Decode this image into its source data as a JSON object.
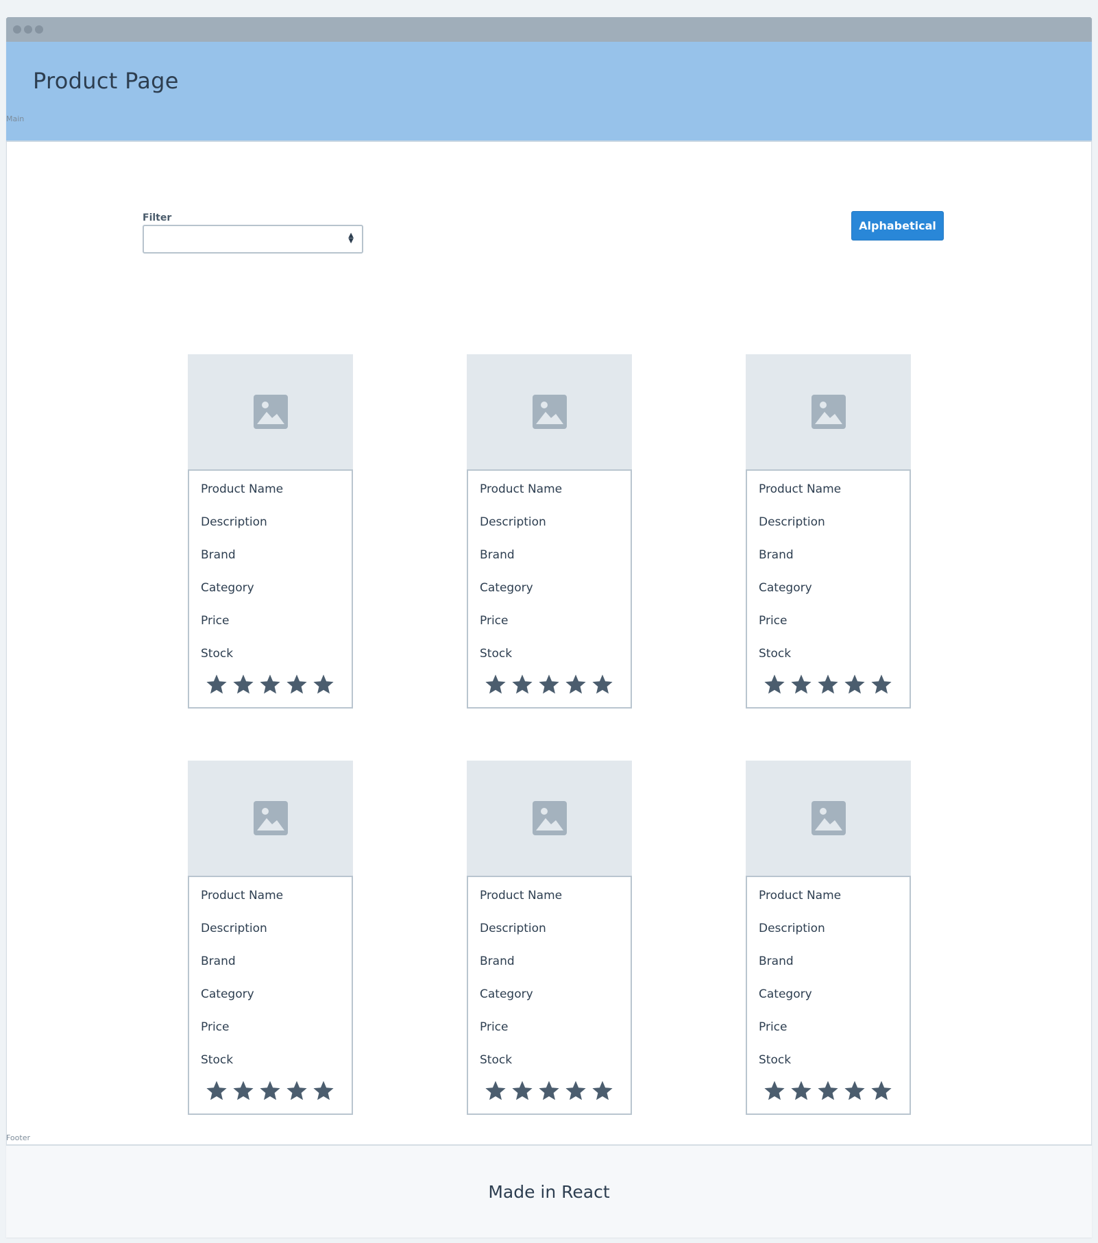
{
  "header": {
    "title": "Product Page",
    "color": "#97c2ea"
  },
  "regions": {
    "main_label": "Main",
    "footer_label": "Footer"
  },
  "filter": {
    "label": "Filter",
    "value": ""
  },
  "sort_button": {
    "label": "Alphabetical",
    "color": "#2987d8"
  },
  "products": [
    {
      "name": "Product Name",
      "description": "Description",
      "brand": "Brand",
      "category": "Category",
      "price": "Price",
      "stock": "Stock",
      "rating": 5
    },
    {
      "name": "Product Name",
      "description": "Description",
      "brand": "Brand",
      "category": "Category",
      "price": "Price",
      "stock": "Stock",
      "rating": 5
    },
    {
      "name": "Product Name",
      "description": "Description",
      "brand": "Brand",
      "category": "Category",
      "price": "Price",
      "stock": "Stock",
      "rating": 5
    },
    {
      "name": "Product Name",
      "description": "Description",
      "brand": "Brand",
      "category": "Category",
      "price": "Price",
      "stock": "Stock",
      "rating": 5
    },
    {
      "name": "Product Name",
      "description": "Description",
      "brand": "Brand",
      "category": "Category",
      "price": "Price",
      "stock": "Stock",
      "rating": 5
    },
    {
      "name": "Product Name",
      "description": "Description",
      "brand": "Brand",
      "category": "Category",
      "price": "Price",
      "stock": "Stock",
      "rating": 5
    }
  ],
  "icons": {
    "image_placeholder": "image-icon",
    "star": "star-icon"
  },
  "footer": {
    "text": "Made in React"
  }
}
